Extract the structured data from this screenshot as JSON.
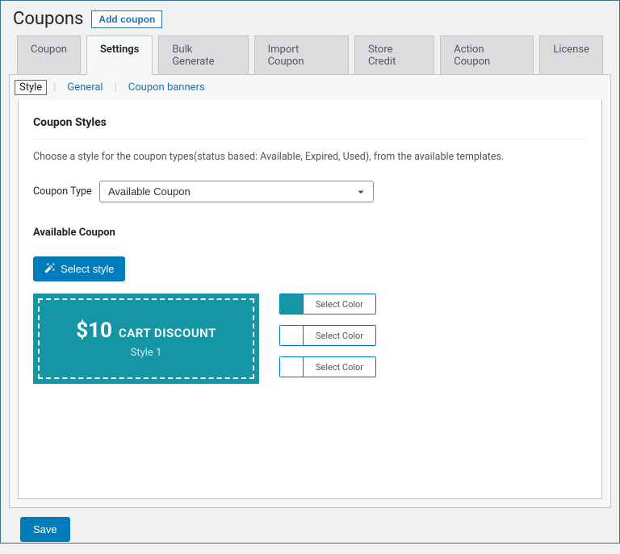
{
  "header": {
    "title": "Coupons",
    "add_button": "Add coupon"
  },
  "tabs": [
    "Coupon",
    "Settings",
    "Bulk Generate",
    "Import Coupon",
    "Store Credit",
    "Action Coupon",
    "License"
  ],
  "active_tab": "Settings",
  "subtabs": [
    "Style",
    "General",
    "Coupon banners"
  ],
  "active_subtab": "Style",
  "section": {
    "title": "Coupon Styles",
    "description": "Choose a style for the coupon types(status based: Available, Expired, Used), from the available templates.",
    "coupon_type_label": "Coupon Type",
    "coupon_type_value": "Available Coupon",
    "subsection_title": "Available Coupon",
    "select_style_label": "Select style",
    "preview": {
      "price": "$10",
      "text": "CART DISCOUNT",
      "style_label": "Style 1"
    },
    "colors": [
      {
        "swatch": "#1596a5",
        "label": "Select Color"
      },
      {
        "swatch": "#ffffff",
        "label": "Select Color"
      },
      {
        "swatch": "#ffffff",
        "label": "Select Color"
      }
    ]
  },
  "footer": {
    "save_label": "Save"
  }
}
